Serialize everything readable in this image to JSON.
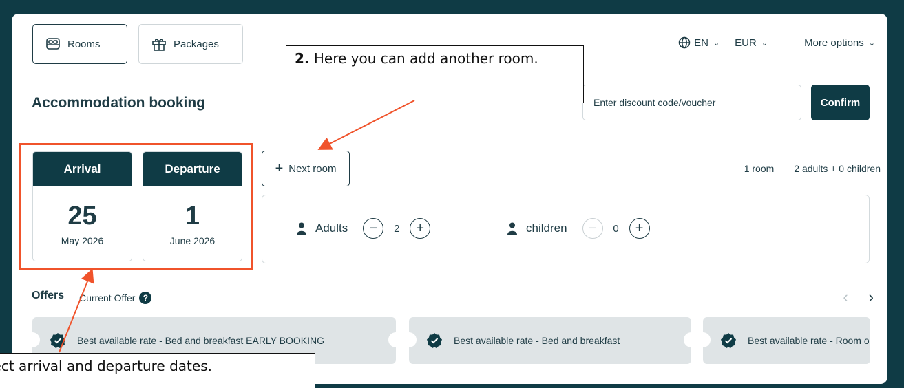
{
  "tabs": [
    {
      "label": "Rooms",
      "icon": "bed-icon",
      "active": true
    },
    {
      "label": "Packages",
      "icon": "gift-icon",
      "active": false
    }
  ],
  "topbar": {
    "language": "EN",
    "currency": "EUR",
    "more": "More options"
  },
  "title": "Accommodation booking",
  "discount": {
    "placeholder": "Enter discount code/voucher",
    "confirm": "Confirm"
  },
  "arrival": {
    "label": "Arrival",
    "day": "25",
    "month": "May 2026"
  },
  "departure": {
    "label": "Departure",
    "day": "1",
    "month": "June 2026"
  },
  "next_room": "Next room",
  "summary": {
    "rooms": "1 room",
    "guests": "2 adults + 0 children"
  },
  "guests": {
    "adults": {
      "label": "Adults",
      "value": "2"
    },
    "children": {
      "label": "children",
      "value": "0"
    }
  },
  "offers": {
    "label": "Offers",
    "current": "Current Offer",
    "items": [
      "Best available rate - Bed and breakfast EARLY BOOKING",
      "Best available rate - Bed and breakfast",
      "Best available rate - Room only"
    ]
  },
  "callouts": {
    "room_number": "2.",
    "room_text": "Here you can add another room.",
    "dates_text": "Select arrival and departure dates."
  },
  "colors": {
    "brand": "#0f3b45",
    "highlight": "#f0532b"
  }
}
